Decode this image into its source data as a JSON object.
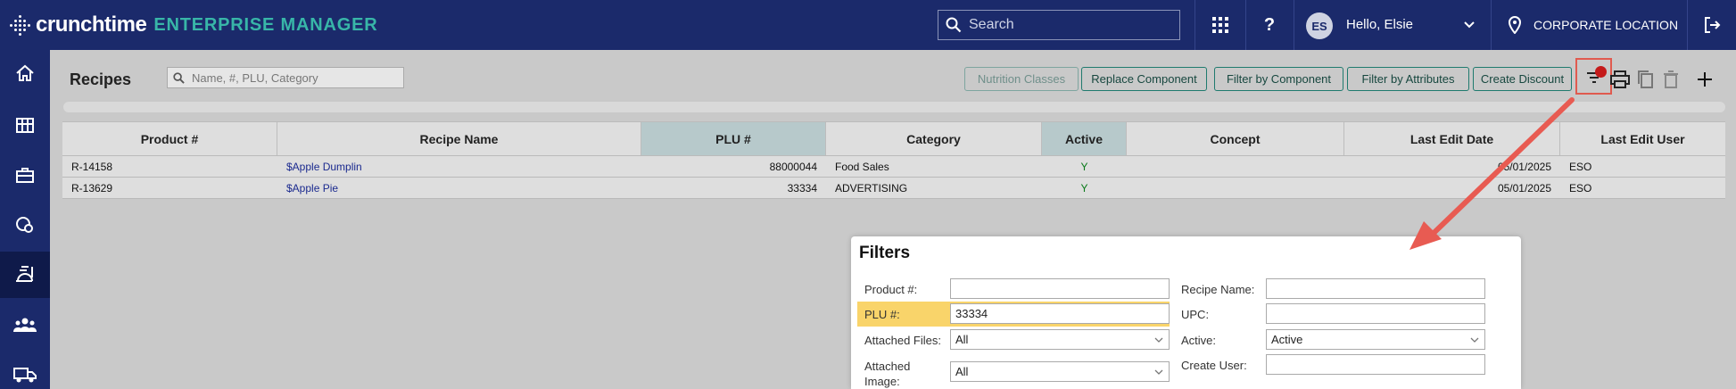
{
  "app": {
    "brand": "crunchtime",
    "product": "ENTERPRISE MANAGER",
    "search_placeholder": "Search",
    "user_initials": "ES",
    "greeting": "Hello, Elsie",
    "location": "CORPORATE LOCATION"
  },
  "nav": {
    "items": [
      {
        "icon": "home-icon"
      },
      {
        "icon": "building-icon"
      },
      {
        "icon": "toolbox-icon"
      },
      {
        "icon": "settings-shield-icon"
      },
      {
        "icon": "recipes-icon",
        "active": true
      },
      {
        "icon": "people-icon"
      },
      {
        "icon": "truck-icon"
      }
    ]
  },
  "page": {
    "title": "Recipes",
    "search_placeholder": "Name, #, PLU, Category"
  },
  "toolbar": {
    "buttons": [
      "Nutrition Classes",
      "Replace Component",
      "Filter by Component",
      "Filter by Attributes",
      "Create Discount"
    ]
  },
  "table": {
    "columns": [
      "Product #",
      "Recipe Name",
      "PLU #",
      "Category",
      "Active",
      "Concept",
      "Last Edit Date",
      "Last Edit User"
    ],
    "rows": [
      {
        "product": "R-14158",
        "name": "$Apple Dumplin",
        "plu": "88000044",
        "category": "Food Sales",
        "active": "Y",
        "concept": "",
        "date": "05/01/2025",
        "user": "ESO"
      },
      {
        "product": "R-13629",
        "name": "$Apple Pie",
        "plu": "33334",
        "category": "ADVERTISING",
        "active": "Y",
        "concept": "",
        "date": "05/01/2025",
        "user": "ESO"
      }
    ]
  },
  "filters": {
    "title": "Filters",
    "product_label": "Product #:",
    "product_value": "",
    "plu_label": "PLU #:",
    "plu_value": "33334",
    "files_label": "Attached Files:",
    "files_value": "All",
    "image_label": "Attached Image:",
    "image_value": "All",
    "recipe_label": "Recipe Name:",
    "recipe_value": "",
    "upc_label": "UPC:",
    "upc_value": "",
    "active_label": "Active:",
    "active_value": "Active",
    "user_label": "Create User:",
    "user_value": ""
  },
  "colors": {
    "navy": "#1b2a6b",
    "teal": "#38b6a8",
    "highlight": "#f9d46a",
    "annotation": "#e05a4f"
  }
}
